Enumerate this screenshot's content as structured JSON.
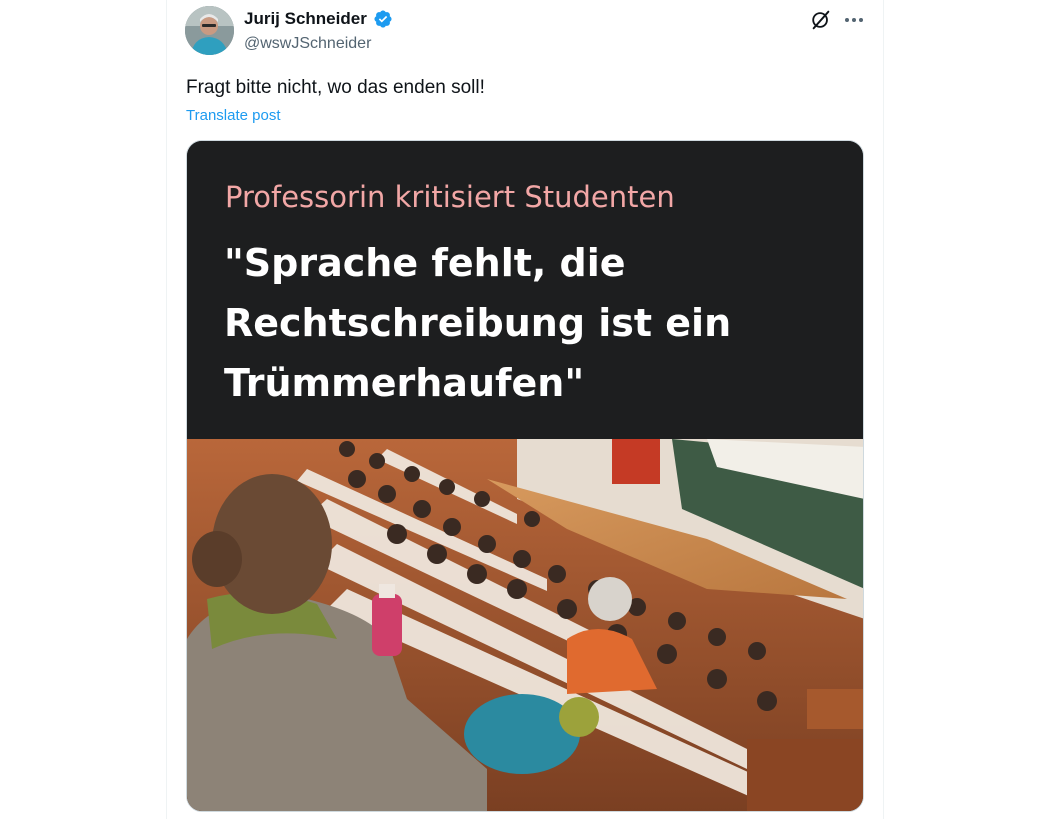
{
  "post": {
    "author": {
      "display_name": "Jurij Schneider",
      "handle": "@wswJSchneider",
      "verified": true
    },
    "icons": {
      "verified": "verified-badge-icon",
      "grok": "grok-icon",
      "more": "more-options-icon"
    },
    "text": "Fragt bitte nicht, wo das enden soll!",
    "translate_label": "Translate post",
    "media": {
      "kicker": "Professorin kritisiert Studenten",
      "headline": "\"Sprache fehlt, die Rechtschreibung ist ein Trümmerhaufen\"",
      "photo_description": "lecture-hall-photo"
    }
  },
  "colors": {
    "link": "#1d9bf0",
    "kicker": "#f2a7a6",
    "media_bg": "#1d1e1f",
    "secondary_text": "#536471"
  }
}
